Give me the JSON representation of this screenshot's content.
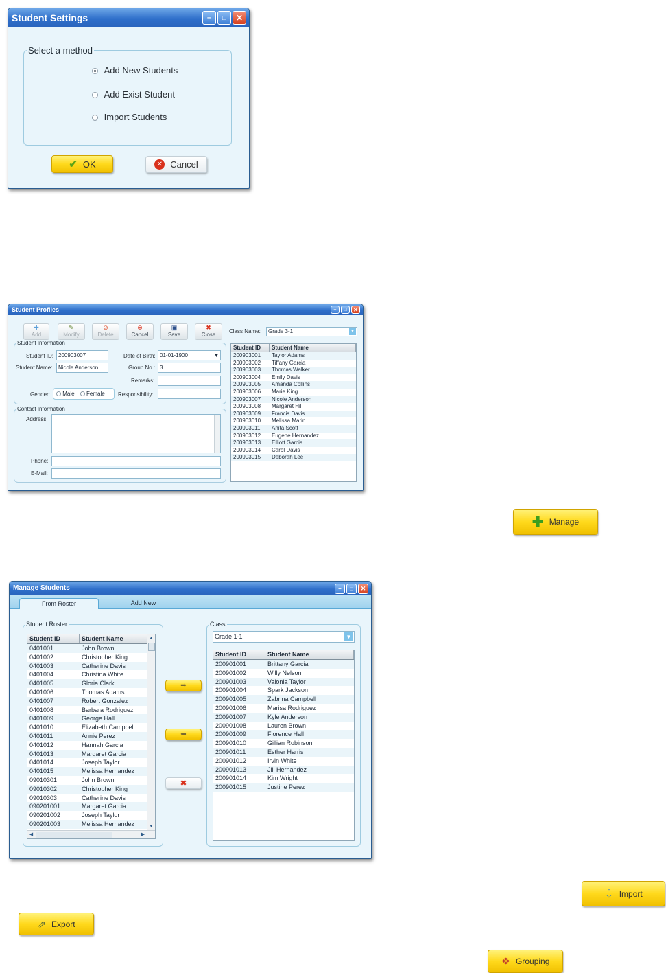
{
  "colors": {
    "title_bar": "#2f6fca",
    "yellow_button": "#ffd91c",
    "panel_bg": "#e9f5fb",
    "row_alt": "#eaf5fa"
  },
  "settings": {
    "title": "Student Settings",
    "group_label": "Select a method",
    "options": [
      "Add New Students",
      "Add Exist Student",
      "Import Students"
    ],
    "selected": "Add New Students",
    "ok": "OK",
    "cancel": "Cancel"
  },
  "profiles": {
    "title": "Student Profiles",
    "toolbar": [
      "Add",
      "Modify",
      "Delete",
      "Cancel",
      "Save",
      "Close"
    ],
    "class_label": "Class Name:",
    "class_value": "Grade 3-1",
    "info_group": "Student Information",
    "student_id_label": "Student ID:",
    "student_id_value": "200903007",
    "student_name_label": "Student Name:",
    "student_name_value": "Nicole Anderson",
    "dob_label": "Date of Birth:",
    "dob_value": "01-01-1900",
    "group_label": "Group No.:",
    "group_value": "3",
    "remarks_label": "Remarks:",
    "gender_label": "Gender:",
    "male": "Male",
    "female": "Female",
    "responsibility_label": "Responsibility:",
    "contact_group": "Contact Information",
    "address_label": "Address:",
    "phone_label": "Phone:",
    "email_label": "E-Mail:",
    "columns": [
      "Student ID",
      "Student Name"
    ],
    "rows": [
      [
        "200903001",
        "Taylor Adams"
      ],
      [
        "200903002",
        "Tiffany Garcia"
      ],
      [
        "200903003",
        "Thomas Walker"
      ],
      [
        "200903004",
        "Emily Davis"
      ],
      [
        "200903005",
        "Amanda Collins"
      ],
      [
        "200903006",
        "Marie King"
      ],
      [
        "200903007",
        "Nicole Anderson"
      ],
      [
        "200903008",
        "Margaret Hill"
      ],
      [
        "200903009",
        "Francis Davis"
      ],
      [
        "200903010",
        "Melissa Marin"
      ],
      [
        "200903011",
        "Anita Scott"
      ],
      [
        "200903012",
        "Eugene Hernandez"
      ],
      [
        "200903013",
        "Elliott Garcia"
      ],
      [
        "200903014",
        "Carol Davis"
      ],
      [
        "200903015",
        "Deborah Lee"
      ]
    ]
  },
  "manage_button": "Manage",
  "manage": {
    "title": "Manage Students",
    "tabs": [
      "From Roster",
      "Add New"
    ],
    "roster_group": "Student Roster",
    "class_group": "Class",
    "class_value": "Grade 1-1",
    "columns": [
      "Student ID",
      "Student Name"
    ],
    "roster_rows": [
      [
        "0401001",
        "John Brown"
      ],
      [
        "0401002",
        "Christopher King"
      ],
      [
        "0401003",
        "Catherine Davis"
      ],
      [
        "0401004",
        "Christina White"
      ],
      [
        "0401005",
        "Gloria Clark"
      ],
      [
        "0401006",
        "Thomas Adams"
      ],
      [
        "0401007",
        "Robert Gonzalez"
      ],
      [
        "0401008",
        "Barbara Rodriguez"
      ],
      [
        "0401009",
        "George Hall"
      ],
      [
        "0401010",
        "Elizabeth Campbell"
      ],
      [
        "0401011",
        "Annie Perez"
      ],
      [
        "0401012",
        "Hannah Garcia"
      ],
      [
        "0401013",
        "Margaret Garcia"
      ],
      [
        "0401014",
        "Joseph Taylor"
      ],
      [
        "0401015",
        "Melissa Hernandez"
      ],
      [
        "09010301",
        "John Brown"
      ],
      [
        "09010302",
        "Christopher King"
      ],
      [
        "09010303",
        "Catherine Davis"
      ],
      [
        "090201001",
        "Margaret Garcia"
      ],
      [
        "090201002",
        "Joseph Taylor"
      ],
      [
        "090201003",
        "Melissa Hernandez"
      ]
    ],
    "class_rows": [
      [
        "200901001",
        "Brittany Garcia"
      ],
      [
        "200901002",
        "Willy Nelson"
      ],
      [
        "200901003",
        "Valonia Taylor"
      ],
      [
        "200901004",
        "Spark Jackson"
      ],
      [
        "200901005",
        "Zabrina Campbell"
      ],
      [
        "200901006",
        "Marisa Rodriguez"
      ],
      [
        "200901007",
        "Kyle Anderson"
      ],
      [
        "200901008",
        "Lauren Brown"
      ],
      [
        "200901009",
        "Florence Hall"
      ],
      [
        "200901010",
        "Gillian Robinson"
      ],
      [
        "200901011",
        "Esther Harris"
      ],
      [
        "200901012",
        "Irvin White"
      ],
      [
        "200901013",
        "Jill Hernandez"
      ],
      [
        "200901014",
        "Kim Wright"
      ],
      [
        "200901015",
        "Justine Perez"
      ]
    ]
  },
  "import_button": "Import",
  "export_button": "Export",
  "grouping_button": "Grouping"
}
